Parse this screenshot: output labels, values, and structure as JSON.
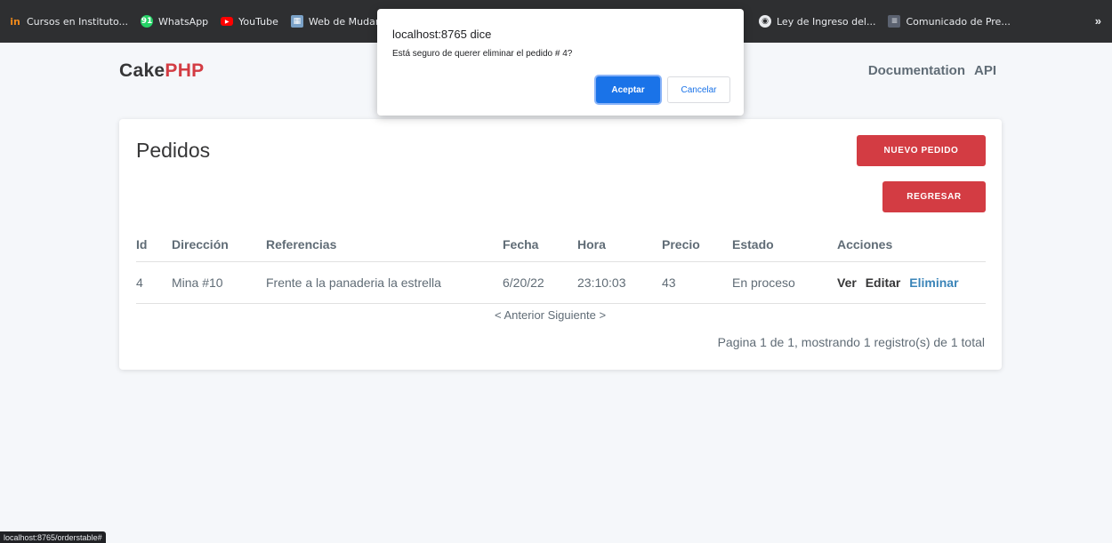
{
  "bookmarks": {
    "items": [
      {
        "label": "Cursos en Instituto...",
        "icon": "institute-icon",
        "glyph": "in"
      },
      {
        "label": "WhatsApp",
        "icon": "whatsapp-icon",
        "glyph": "91"
      },
      {
        "label": "YouTube",
        "icon": "youtube-icon",
        "glyph": "▶"
      },
      {
        "label": "Web de Mudanza",
        "icon": "web-icon",
        "glyph": "▦"
      }
    ],
    "right_items": [
      {
        "label": "Ley de Ingreso del...",
        "icon": "globe-icon",
        "glyph": "◉"
      },
      {
        "label": "Comunicado de Pre...",
        "icon": "document-icon",
        "glyph": "≡"
      }
    ],
    "more": "»"
  },
  "header": {
    "brand_part1": "Cake",
    "brand_part2": "PHP",
    "nav": [
      "Documentation",
      "API"
    ]
  },
  "page": {
    "title": "Pedidos",
    "new_button": "NUEVO PEDIDO",
    "back_button": "REGRESAR",
    "columns": [
      "Id",
      "Dirección",
      "Referencias",
      "Fecha",
      "Hora",
      "Precio",
      "Estado",
      "Acciones"
    ],
    "rows": [
      {
        "id": "4",
        "direccion": "Mina #10",
        "referencias": "Frente a la panaderia la estrella",
        "fecha": "6/20/22",
        "hora": "23:10:03",
        "precio": "43",
        "estado": "En proceso",
        "actions": [
          "Ver",
          "Editar",
          "Eliminar"
        ]
      }
    ],
    "pager": "< Anterior  Siguiente >",
    "counter": "Pagina 1 de 1, mostrando 1 registro(s) de 1 total"
  },
  "dialog": {
    "title": "localhost:8765 dice",
    "message": "Está seguro de querer eliminar el pedido # 4?",
    "ok": "Aceptar",
    "cancel": "Cancelar"
  },
  "status_url": "localhost:8765/orderstable#",
  "colors": {
    "accent": "#d33c43",
    "link": "#3a84b8",
    "dialog_primary": "#1a73e8"
  }
}
